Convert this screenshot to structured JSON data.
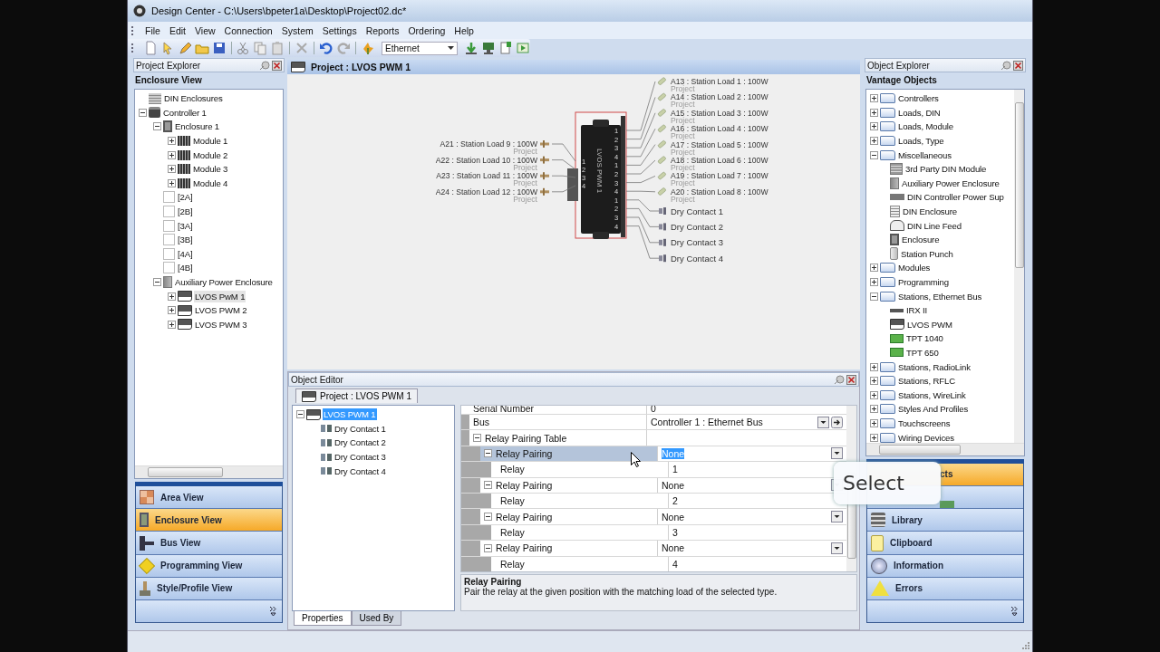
{
  "window": {
    "title": "Design Center - C:\\Users\\bpeter1a\\Desktop\\Project02.dc*"
  },
  "menu": [
    "File",
    "Edit",
    "View",
    "Connection",
    "System",
    "Settings",
    "Reports",
    "Ordering",
    "Help"
  ],
  "toolbar": {
    "connection": "Ethernet"
  },
  "project_explorer": {
    "title": "Project Explorer",
    "view_title": "Enclosure View",
    "tree": [
      {
        "label": "DIN Enclosures",
        "kind": "enclosures",
        "selected": false
      },
      {
        "label": "Controller 1",
        "kind": "controller",
        "expanded": true,
        "selected": false,
        "children": [
          {
            "label": "Enclosure 1",
            "kind": "enclosure",
            "expanded": true,
            "selected": false,
            "children": [
              {
                "label": "Module 1",
                "kind": "module",
                "expanded": false,
                "selected": false
              },
              {
                "label": "Module 2",
                "kind": "module",
                "expanded": false,
                "selected": false
              },
              {
                "label": "Module 3",
                "kind": "module",
                "expanded": false,
                "selected": false
              },
              {
                "label": "Module 4",
                "kind": "module",
                "expanded": false,
                "selected": false
              }
            ]
          },
          {
            "label": "[2A]",
            "kind": "slot",
            "selected": false
          },
          {
            "label": "[2B]",
            "kind": "slot",
            "selected": false
          },
          {
            "label": "[3A]",
            "kind": "slot",
            "selected": false
          },
          {
            "label": "[3B]",
            "kind": "slot",
            "selected": false
          },
          {
            "label": "[4A]",
            "kind": "slot",
            "selected": false
          },
          {
            "label": "[4B]",
            "kind": "slot",
            "selected": false
          },
          {
            "label": "Auxiliary Power Enclosure",
            "kind": "aux",
            "expanded": true,
            "selected": false,
            "children": [
              {
                "label": "LVOS PwM 1",
                "kind": "lvos",
                "expanded": false,
                "selected": true
              },
              {
                "label": "LVOS PWM 2",
                "kind": "lvos",
                "expanded": false,
                "selected": false
              },
              {
                "label": "LVOS PWM 3",
                "kind": "lvos",
                "expanded": false,
                "selected": false
              }
            ]
          }
        ]
      }
    ]
  },
  "navigation": [
    {
      "label": "Area View",
      "kind": "area",
      "selected": false
    },
    {
      "label": "Enclosure View",
      "kind": "enclosure",
      "selected": true
    },
    {
      "label": "Bus View",
      "kind": "bus",
      "selected": false
    },
    {
      "label": "Programming View",
      "kind": "programming",
      "selected": false
    },
    {
      "label": "Style/Profile View",
      "kind": "style",
      "selected": false
    }
  ],
  "diagram": {
    "title": "Project : LVOS PWM 1",
    "device": {
      "name": "LVOS PWM 1",
      "left_pins": [
        "1",
        "2",
        "3",
        "4"
      ],
      "right_pins": [
        "1",
        "2",
        "3",
        "4",
        "1",
        "2",
        "3",
        "4",
        "1",
        "2",
        "3",
        "4"
      ]
    },
    "left_loads": [
      {
        "label": "A21 : Station Load 9 : 100W",
        "location": "Project"
      },
      {
        "label": "A22 : Station Load 10 : 100W",
        "location": "Project"
      },
      {
        "label": "A23 : Station Load 11 : 100W",
        "location": "Project"
      },
      {
        "label": "A24 : Station Load 12 : 100W",
        "location": "Project"
      }
    ],
    "right_loads": [
      {
        "label": "A13 : Station Load 1 : 100W",
        "location": "Project"
      },
      {
        "label": "A14 : Station Load 2 : 100W",
        "location": "Project"
      },
      {
        "label": "A15 : Station Load 3 : 100W",
        "location": "Project"
      },
      {
        "label": "A16 : Station Load 4 : 100W",
        "location": "Project"
      },
      {
        "label": "A17 : Station Load 5 : 100W",
        "location": "Project"
      },
      {
        "label": "A18 : Station Load 6 : 100W",
        "location": "Project"
      },
      {
        "label": "A19 : Station Load 7 : 100W",
        "location": "Project"
      },
      {
        "label": "A20 : Station Load 8 : 100W",
        "location": "Project"
      }
    ],
    "contacts": [
      "Dry Contact 1",
      "Dry Contact 2",
      "Dry Contact 3",
      "Dry Contact 4"
    ]
  },
  "object_editor": {
    "title": "Object Editor",
    "tab": "Project : LVOS PWM 1",
    "tree": [
      {
        "label": "LVOS PWM 1",
        "kind": "device",
        "expanded": true,
        "selected": true,
        "children": [
          {
            "label": "Dry Contact 1",
            "kind": "contact",
            "selected": false
          },
          {
            "label": "Dry Contact 2",
            "kind": "contact",
            "selected": false
          },
          {
            "label": "Dry Contact 3",
            "kind": "contact",
            "selected": false
          },
          {
            "label": "Dry Contact 4",
            "kind": "contact",
            "selected": false
          }
        ]
      }
    ],
    "properties": [
      {
        "name": "Serial Number",
        "value": "0",
        "kind": "text",
        "selected": false
      },
      {
        "name": "Bus",
        "value": "Controller 1 : Ethernet Bus",
        "kind": "link",
        "selected": false
      },
      {
        "name": "Relay Pairing Table",
        "kind": "category",
        "expanded": true,
        "selected": false,
        "children": [
          {
            "name": "Relay Pairing",
            "value": "None",
            "kind": "dropdown",
            "expanded": true,
            "selected": true,
            "children": [
              {
                "name": "Relay",
                "value": "1",
                "kind": "text",
                "selected": false
              }
            ]
          },
          {
            "name": "Relay Pairing",
            "value": "None",
            "kind": "dropdown",
            "expanded": true,
            "selected": false,
            "children": [
              {
                "name": "Relay",
                "value": "2",
                "kind": "text",
                "selected": false
              }
            ]
          },
          {
            "name": "Relay Pairing",
            "value": "None",
            "kind": "dropdown",
            "expanded": true,
            "selected": false,
            "children": [
              {
                "name": "Relay",
                "value": "3",
                "kind": "text",
                "selected": false
              }
            ]
          },
          {
            "name": "Relay Pairing",
            "value": "None",
            "kind": "dropdown",
            "expanded": true,
            "selected": false,
            "children": [
              {
                "name": "Relay",
                "value": "4",
                "kind": "text",
                "selected": false
              }
            ]
          }
        ]
      }
    ],
    "description": {
      "title": "Relay Pairing",
      "text": "Pair the relay at the given position with the matching load of the selected type."
    },
    "tabs": [
      {
        "label": "Properties",
        "selected": true
      },
      {
        "label": "Used By",
        "selected": false
      }
    ]
  },
  "object_explorer": {
    "title": "Object Explorer",
    "view_title": "Vantage Objects",
    "tree": [
      {
        "label": "Controllers",
        "kind": "folder",
        "expanded": false,
        "selected": false
      },
      {
        "label": "Loads, DIN",
        "kind": "folder",
        "expanded": false,
        "selected": false
      },
      {
        "label": "Loads, Module",
        "kind": "folder",
        "expanded": false,
        "selected": false
      },
      {
        "label": "Loads, Type",
        "kind": "folder",
        "expanded": false,
        "selected": false
      },
      {
        "label": "Miscellaneous",
        "kind": "folder",
        "expanded": true,
        "selected": false,
        "children": [
          {
            "label": "3rd Party DIN Module",
            "kind": "din-module",
            "selected": false
          },
          {
            "label": "Auxiliary Power Enclosure",
            "kind": "aux",
            "selected": false
          },
          {
            "label": "DIN Controller Power Sup",
            "kind": "power-supply",
            "selected": false
          },
          {
            "label": "DIN Enclosure",
            "kind": "din-enclosure",
            "selected": false
          },
          {
            "label": "DIN Line Feed",
            "kind": "line-feed",
            "selected": false
          },
          {
            "label": "Enclosure",
            "kind": "enclosure",
            "selected": false
          },
          {
            "label": "Station Punch",
            "kind": "punch",
            "selected": false
          }
        ]
      },
      {
        "label": "Modules",
        "kind": "folder",
        "expanded": false,
        "selected": false
      },
      {
        "label": "Programming",
        "kind": "folder",
        "expanded": false,
        "selected": false
      },
      {
        "label": "Stations, Ethernet Bus",
        "kind": "folder",
        "expanded": true,
        "selected": false,
        "children": [
          {
            "label": "IRX II",
            "kind": "irx",
            "selected": false
          },
          {
            "label": "LVOS PWM",
            "kind": "lvos",
            "selected": false
          },
          {
            "label": "TPT 1040",
            "kind": "tpt",
            "selected": false
          },
          {
            "label": "TPT 650",
            "kind": "tpt",
            "selected": false
          }
        ]
      },
      {
        "label": "Stations, RadioLink",
        "kind": "folder",
        "expanded": false,
        "selected": false
      },
      {
        "label": "Stations, RFLC",
        "kind": "folder",
        "expanded": false,
        "selected": false
      },
      {
        "label": "Stations, WireLink",
        "kind": "folder",
        "expanded": false,
        "selected": false
      },
      {
        "label": "Styles And Profiles",
        "kind": "folder",
        "expanded": false,
        "selected": false
      },
      {
        "label": "Touchscreens",
        "kind": "folder",
        "expanded": false,
        "selected": false
      },
      {
        "label": "Wiring Devices",
        "kind": "folder",
        "expanded": false,
        "selected": false
      }
    ]
  },
  "object_navigation": [
    {
      "label": "cts",
      "kind": "objects",
      "selected": true,
      "under_tooltip": true
    },
    {
      "kind": "favorites",
      "selected": false,
      "under_tooltip": true
    },
    {
      "label": "Library",
      "kind": "library",
      "selected": false,
      "under_tooltip": false
    },
    {
      "label": "Clipboard",
      "kind": "clipboard",
      "selected": false,
      "under_tooltip": false
    },
    {
      "label": "Information",
      "kind": "information",
      "selected": false,
      "under_tooltip": false
    },
    {
      "label": "Errors",
      "kind": "errors",
      "selected": false,
      "under_tooltip": false
    }
  ],
  "tooltip": "Select"
}
